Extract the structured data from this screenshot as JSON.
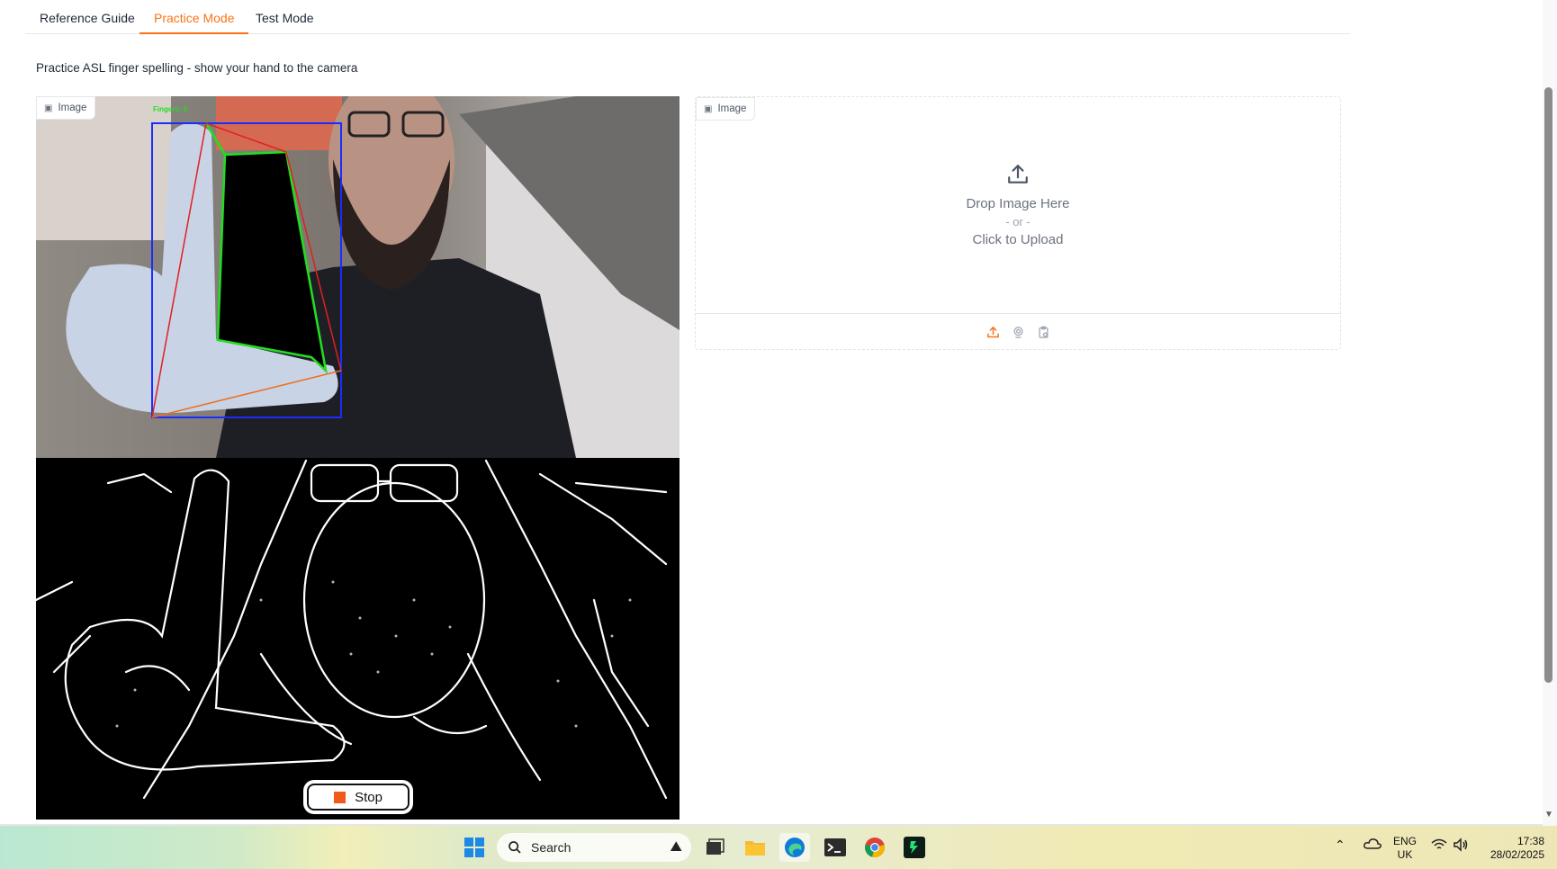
{
  "tabs": [
    {
      "label": "Reference Guide",
      "active": false
    },
    {
      "label": "Practice Mode",
      "active": true
    },
    {
      "label": "Test Mode",
      "active": false
    }
  ],
  "subtitle": "Practice ASL finger spelling - show your hand to the camera",
  "webcam": {
    "badge_label": "Image",
    "overlay_text": "Fingers: 0",
    "stop_label": "Stop"
  },
  "upload": {
    "badge_label": "Image",
    "drop_text": "Drop Image Here",
    "or_text": "- or -",
    "click_text": "Click to Upload",
    "sources": [
      "upload-icon",
      "webcam-icon",
      "clipboard-icon"
    ],
    "accent_color": "#f97316"
  },
  "taskbar": {
    "search_placeholder": "Search",
    "language": "ENG",
    "region": "UK",
    "time": "17:38",
    "date": "28/02/2025",
    "apps": [
      "windows-start-icon",
      "task-view-icon",
      "file-explorer-icon",
      "edge-icon",
      "terminal-icon",
      "chrome-icon",
      "app-icon"
    ]
  }
}
